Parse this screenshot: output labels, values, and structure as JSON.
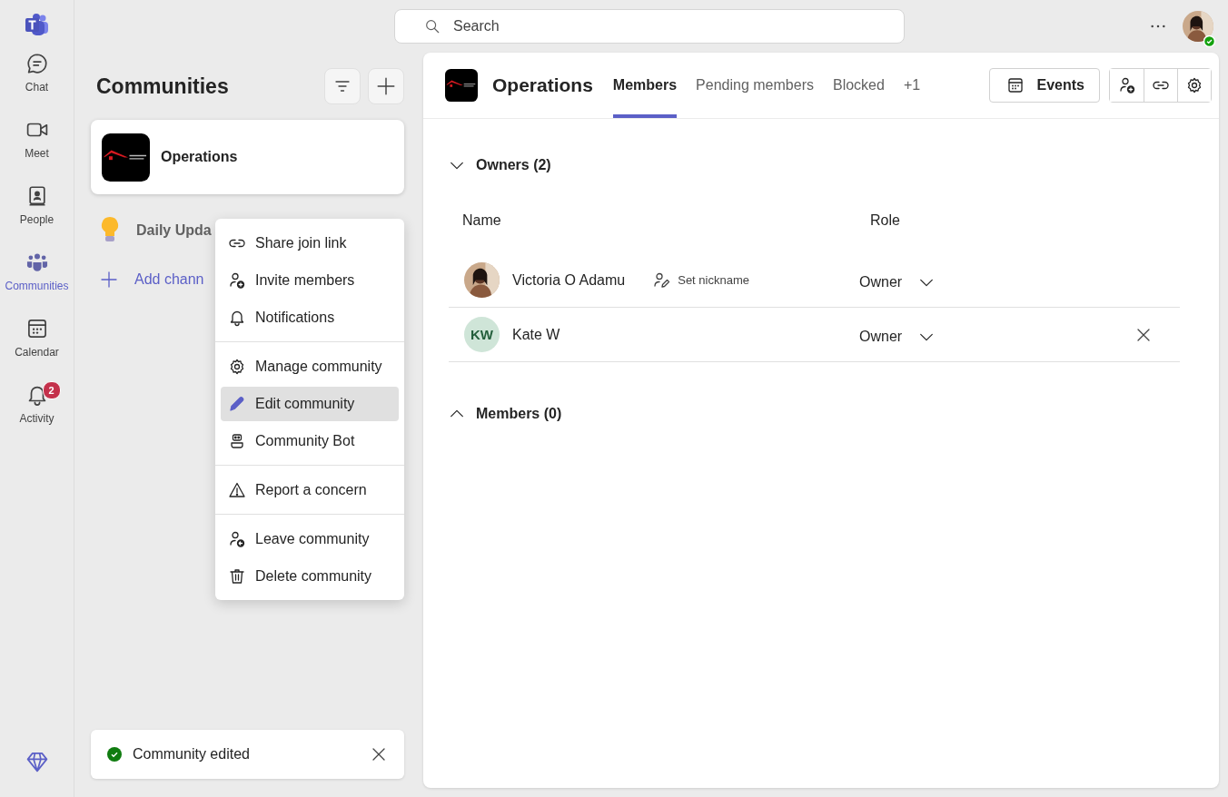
{
  "rail": {
    "items": [
      {
        "label": "Chat",
        "selected": false
      },
      {
        "label": "Meet",
        "selected": false
      },
      {
        "label": "People",
        "selected": false
      },
      {
        "label": "Communities",
        "selected": true
      },
      {
        "label": "Calendar",
        "selected": false
      },
      {
        "label": "Activity",
        "selected": false,
        "badge": "2"
      }
    ]
  },
  "search": {
    "placeholder": "Search"
  },
  "sidebar": {
    "title": "Communities",
    "communities": [
      {
        "name": "Operations",
        "selected": true
      }
    ],
    "channels": [
      {
        "kind": "channel",
        "label": "Daily Upda"
      },
      {
        "kind": "add",
        "label": "Add chann"
      }
    ]
  },
  "context_menu": {
    "groups": [
      [
        {
          "label": "Share join link",
          "highlighted": false
        },
        {
          "label": "Invite members",
          "highlighted": false
        },
        {
          "label": "Notifications",
          "highlighted": false
        }
      ],
      [
        {
          "label": "Manage community",
          "highlighted": false
        },
        {
          "label": "Edit community",
          "highlighted": true
        },
        {
          "label": "Community Bot",
          "highlighted": false
        }
      ],
      [
        {
          "label": "Report a concern",
          "highlighted": false
        }
      ],
      [
        {
          "label": "Leave community",
          "highlighted": false
        },
        {
          "label": "Delete community",
          "highlighted": false
        }
      ]
    ]
  },
  "toast": {
    "message": "Community edited"
  },
  "panel": {
    "title": "Operations",
    "tabs": [
      {
        "label": "Members",
        "selected": true
      },
      {
        "label": "Pending members",
        "selected": false
      },
      {
        "label": "Blocked",
        "selected": false
      }
    ],
    "overflow": "+1",
    "events_button": "Events",
    "sections": [
      {
        "title": "Owners (2)",
        "expanded": true,
        "columns": [
          "Name",
          "Role"
        ],
        "rows": [
          {
            "name": "Victoria O Adamu",
            "nickname_action": "Set nickname",
            "role": "Owner",
            "removable": false
          },
          {
            "avatar": {
              "kind": "initials",
              "text": "KW"
            },
            "name": "Kate W",
            "role": "Owner",
            "removable": true
          }
        ]
      },
      {
        "title": "Members (0)",
        "expanded": false
      }
    ]
  }
}
